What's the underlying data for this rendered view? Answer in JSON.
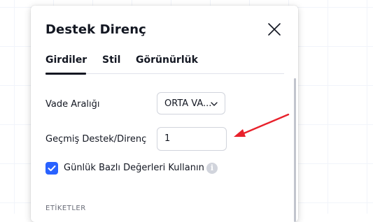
{
  "dialog": {
    "title": "Destek Direnç"
  },
  "tabs": [
    {
      "label": "Girdiler",
      "active": true
    },
    {
      "label": "Stil",
      "active": false
    },
    {
      "label": "Görünürlük",
      "active": false
    }
  ],
  "fields": {
    "term_range": {
      "label": "Vade Aralığı",
      "value": "ORTA VA..."
    },
    "past_support": {
      "label": "Geçmiş Destek/Direnç",
      "value": "1"
    },
    "daily_values": {
      "label": "Günlük Bazlı Değerleri Kullanın",
      "checked": true
    }
  },
  "section": {
    "label": "ETİKETLER"
  },
  "icons": {
    "close": "close-icon",
    "chevron": "chevron-down-icon",
    "check": "check-icon",
    "info": "info-icon",
    "arrow": "red-arrow-annotation"
  },
  "colors": {
    "accent": "#2962ff",
    "arrow": "#e8212b",
    "text": "#131722",
    "muted": "#6a6d78",
    "border": "#d1d4dc"
  }
}
